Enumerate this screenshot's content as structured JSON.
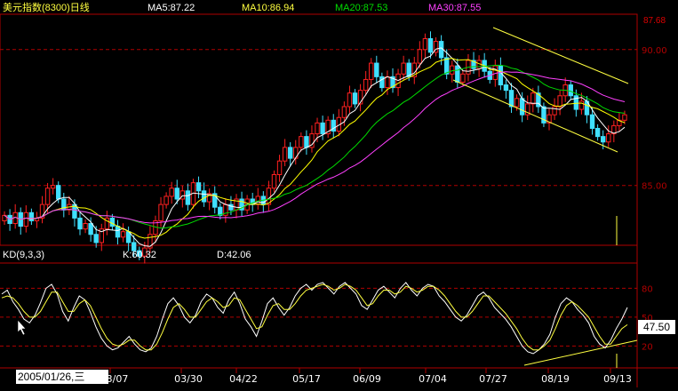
{
  "header": {
    "title": "美元指数(8300)日线",
    "ma5": "MA5:87.22",
    "ma10": "MA10:86.94",
    "ma20": "MA20:87.53",
    "ma30": "MA30:87.55"
  },
  "indicator": {
    "name": "KD(9,3,3)",
    "k": "K:60.32",
    "d": "D:42.06",
    "current_value_box": "47.50"
  },
  "cursor_date": "2005/01/26,三",
  "last_price_label": "87.68",
  "colors": {
    "up": "#ff2020",
    "down": "#40e0ff",
    "ma5": "#ffffff",
    "ma10": "#ffff00",
    "ma20": "#00dd00",
    "ma30": "#ff40ff",
    "grid": "#b00000",
    "trend": "#ffff40"
  },
  "chart_data": [
    {
      "type": "candlestick",
      "title": "美元指数(8300)日线",
      "ylim": [
        82.8,
        91.3
      ],
      "y_ticks": [
        90.0,
        85.0
      ],
      "x_ticks": [
        "3/07",
        "03/30",
        "04/22",
        "05/17",
        "06/09",
        "07/04",
        "07/27",
        "08/19",
        "09/13"
      ],
      "close": [
        83.9,
        83.6,
        84.0,
        83.5,
        84.0,
        83.7,
        83.8,
        84.3,
        84.9,
        85.0,
        84.5,
        84.1,
        84.3,
        83.8,
        83.4,
        83.6,
        83.2,
        82.9,
        83.4,
        83.8,
        83.5,
        83.1,
        83.3,
        82.9,
        82.6,
        82.4,
        82.7,
        83.2,
        83.7,
        84.3,
        84.6,
        84.9,
        84.5,
        84.8,
        84.3,
        85.1,
        84.8,
        84.4,
        84.7,
        84.2,
        83.9,
        84.3,
        84.1,
        84.5,
        84.1,
        84.5,
        84.3,
        84.6,
        84.3,
        84.9,
        85.4,
        85.9,
        86.4,
        86.0,
        86.4,
        86.8,
        86.4,
        86.9,
        87.3,
        86.9,
        87.4,
        87.0,
        87.5,
        87.9,
        88.4,
        88.0,
        88.5,
        88.9,
        89.5,
        89.0,
        88.6,
        89.0,
        88.6,
        89.1,
        89.5,
        89.0,
        89.5,
        90.0,
        90.4,
        89.9,
        90.3,
        89.7,
        89.1,
        89.4,
        88.8,
        89.1,
        89.6,
        89.3,
        89.6,
        89.2,
        88.9,
        89.4,
        88.7,
        88.5,
        87.9,
        88.2,
        87.6,
        88.0,
        88.4,
        87.9,
        87.3,
        87.6,
        87.9,
        88.3,
        88.7,
        88.3,
        87.8,
        88.1,
        87.6,
        87.1,
        86.8,
        86.6,
        86.9,
        87.2,
        87.4,
        87.6
      ],
      "series": [
        {
          "name": "MA5",
          "value": 87.22
        },
        {
          "name": "MA10",
          "value": 86.94
        },
        {
          "name": "MA20",
          "value": 87.53
        },
        {
          "name": "MA30",
          "value": 87.55
        }
      ]
    },
    {
      "type": "line",
      "title": "KD(9,3,3)",
      "ylim": [
        0,
        100
      ],
      "y_ticks": [
        80,
        50,
        20
      ],
      "series": [
        {
          "name": "K",
          "last": 60.32,
          "values": [
            74,
            78,
            66,
            58,
            48,
            44,
            52,
            65,
            80,
            84,
            74,
            56,
            46,
            60,
            72,
            68,
            55,
            40,
            28,
            20,
            16,
            18,
            24,
            30,
            22,
            16,
            14,
            18,
            30,
            48,
            64,
            70,
            62,
            50,
            44,
            52,
            66,
            74,
            70,
            60,
            54,
            68,
            76,
            64,
            48,
            40,
            30,
            46,
            64,
            70,
            60,
            52,
            60,
            72,
            80,
            84,
            78,
            84,
            86,
            80,
            74,
            82,
            86,
            80,
            74,
            62,
            58,
            68,
            78,
            82,
            76,
            70,
            80,
            86,
            78,
            72,
            80,
            84,
            82,
            72,
            66,
            58,
            50,
            46,
            52,
            62,
            72,
            76,
            70,
            60,
            54,
            48,
            40,
            30,
            20,
            14,
            12,
            16,
            22,
            32,
            50,
            64,
            70,
            66,
            58,
            52,
            44,
            30,
            22,
            18,
            26,
            38,
            48,
            60
          ]
        },
        {
          "name": "D",
          "last": 42.06,
          "values": [
            70,
            72,
            70,
            64,
            56,
            50,
            50,
            56,
            66,
            76,
            76,
            66,
            56,
            56,
            64,
            68,
            62,
            50,
            38,
            28,
            22,
            20,
            22,
            26,
            26,
            20,
            16,
            16,
            22,
            34,
            48,
            60,
            64,
            58,
            50,
            50,
            58,
            66,
            70,
            66,
            60,
            62,
            70,
            68,
            58,
            48,
            38,
            40,
            52,
            62,
            64,
            58,
            58,
            64,
            72,
            78,
            80,
            82,
            84,
            82,
            78,
            80,
            84,
            82,
            78,
            70,
            62,
            64,
            72,
            78,
            78,
            74,
            76,
            82,
            80,
            76,
            78,
            82,
            82,
            78,
            72,
            64,
            56,
            50,
            50,
            56,
            64,
            72,
            72,
            66,
            60,
            54,
            46,
            38,
            28,
            20,
            16,
            16,
            20,
            26,
            38,
            52,
            62,
            66,
            62,
            56,
            50,
            40,
            30,
            22,
            22,
            30,
            38,
            42.06
          ]
        }
      ]
    }
  ]
}
